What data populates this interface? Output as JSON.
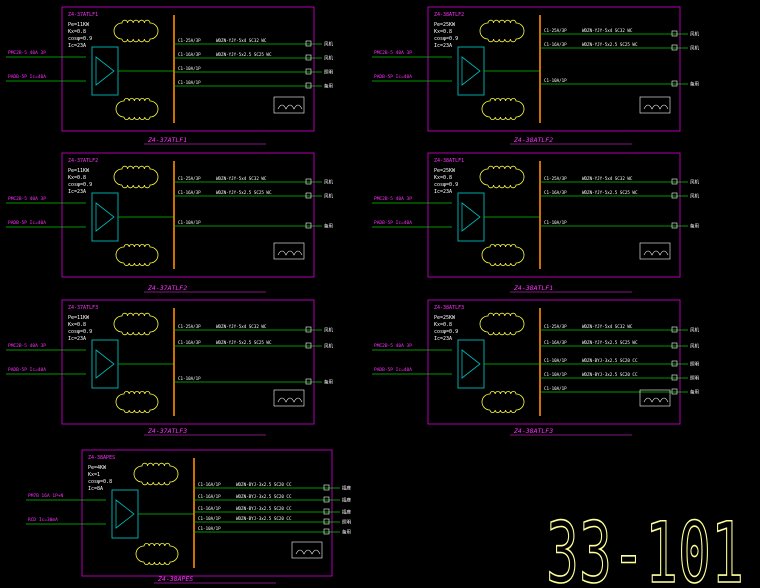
{
  "sheet_number": "33-101",
  "colors": {
    "background": "#000000",
    "frame": "#b000b0",
    "busbar": "#ff8c00",
    "wire": "#00c800",
    "text": "#ffffff",
    "label": "#ff2fff",
    "device": "#00bcbc",
    "cloud": "#ffff40",
    "sheet_number": "#ffff99"
  },
  "panels": [
    {
      "id": "p1",
      "title": "Z4-37ATLF1",
      "specs": [
        "Pe=11KW",
        "Kx=0.8",
        "cosφ=0.9",
        "Ic=23A"
      ],
      "inputs": [
        "PMC2B-5 40A 3P",
        "PADB-5P Ic=40A"
      ],
      "feeders": [
        {
          "breaker": "C1-25A/3P",
          "cable": "WDZN-YJY-5x4 SC32 WC",
          "load": "风机"
        },
        {
          "breaker": "C1-16A/3P",
          "cable": "WDZN-YJY-5x2.5 SC25 WC",
          "load": "风机"
        },
        {
          "breaker": "C1-10A/1P",
          "cable": "",
          "load": "照明"
        },
        {
          "breaker": "C1-10A/1P",
          "cable": "",
          "load": "备用"
        }
      ]
    },
    {
      "id": "p2",
      "title": "Z4-38ATLF2",
      "specs": [
        "Pe=25KW",
        "Kx=0.8",
        "cosφ=0.9",
        "Ic=23A"
      ],
      "inputs": [
        "PMC2B-5 40A 3P",
        "PADB-5P Ic=40A"
      ],
      "feeders": [
        {
          "breaker": "C1-25A/3P",
          "cable": "WDZN-YJY-5x4 SC32 WC",
          "load": "风机"
        },
        {
          "breaker": "C1-16A/3P",
          "cable": "WDZN-YJY-5x2.5 SC25 WC",
          "load": "风机"
        },
        {
          "breaker": "C1-10A/1P",
          "cable": "",
          "load": "备用"
        }
      ]
    },
    {
      "id": "p3",
      "title": "Z4-37ATLF2",
      "specs": [
        "Pe=11KW",
        "Kx=0.8",
        "cosφ=0.9",
        "Ic=23A"
      ],
      "inputs": [
        "PMC2B-5 40A 3P",
        "PADB-5P Ic=40A"
      ],
      "feeders": [
        {
          "breaker": "C1-25A/3P",
          "cable": "WDZN-YJY-5x4 SC32 WC",
          "load": "风机"
        },
        {
          "breaker": "C1-16A/3P",
          "cable": "WDZN-YJY-5x2.5 SC25 WC",
          "load": "风机"
        },
        {
          "breaker": "C1-10A/1P",
          "cable": "",
          "load": "备用"
        }
      ]
    },
    {
      "id": "p4",
      "title": "Z4-38ATLF1",
      "specs": [
        "Pe=25KW",
        "Kx=0.8",
        "cosφ=0.9",
        "Ic=23A"
      ],
      "inputs": [
        "PMC2B-5 40A 3P",
        "PADB-5P Ic=40A"
      ],
      "feeders": [
        {
          "breaker": "C1-25A/3P",
          "cable": "WDZN-YJY-5x4 SC32 WC",
          "load": "风机"
        },
        {
          "breaker": "C1-16A/3P",
          "cable": "WDZN-YJY-5x2.5 SC25 WC",
          "load": "风机"
        },
        {
          "breaker": "C1-10A/1P",
          "cable": "",
          "load": "备用"
        }
      ]
    },
    {
      "id": "p5",
      "title": "Z4-37ATLF3",
      "specs": [
        "Pe=11KW",
        "Kx=0.8",
        "cosφ=0.9",
        "Ic=23A"
      ],
      "inputs": [
        "PMC2B-5 40A 3P",
        "PADB-5P Ic=40A"
      ],
      "feeders": [
        {
          "breaker": "C1-25A/3P",
          "cable": "WDZN-YJY-5x4 SC32 WC",
          "load": "风机"
        },
        {
          "breaker": "C1-16A/3P",
          "cable": "WDZN-YJY-5x2.5 SC25 WC",
          "load": "风机"
        },
        {
          "breaker": "C1-10A/1P",
          "cable": "",
          "load": "备用"
        }
      ]
    },
    {
      "id": "p6",
      "title": "Z4-38ATLF3",
      "specs": [
        "Pe=25KW",
        "Kx=0.8",
        "cosφ=0.9",
        "Ic=23A"
      ],
      "inputs": [
        "PMC2B-5 40A 3P",
        "PADB-5P Ic=40A"
      ],
      "feeders": [
        {
          "breaker": "C1-25A/3P",
          "cable": "WDZN-YJY-5x4 SC32 WC",
          "load": "风机"
        },
        {
          "breaker": "C1-16A/3P",
          "cable": "WDZN-YJY-5x2.5 SC25 WC",
          "load": "风机"
        },
        {
          "breaker": "C1-10A/1P",
          "cable": "WDZN-BYJ-3x2.5 SC20 CC",
          "load": "照明"
        },
        {
          "breaker": "C1-10A/1P",
          "cable": "WDZN-BYJ-3x2.5 SC20 CC",
          "load": "照明"
        },
        {
          "breaker": "C1-10A/1P",
          "cable": "",
          "load": "备用"
        }
      ]
    },
    {
      "id": "p7",
      "title": "Z4-38APES",
      "specs": [
        "Pe=4KW",
        "Kx=1",
        "cosφ=0.8",
        "Ic=8A"
      ],
      "inputs": [
        "PM7B 16A 1P+N",
        "RCD Ic=30mA"
      ],
      "feeders": [
        {
          "breaker": "C1-16A/1P",
          "cable": "WDZN-BYJ-3x2.5 SC20 CC",
          "load": "插座"
        },
        {
          "breaker": "C1-16A/1P",
          "cable": "WDZN-BYJ-3x2.5 SC20 CC",
          "load": "插座"
        },
        {
          "breaker": "C1-16A/1P",
          "cable": "WDZN-BYJ-3x2.5 SC20 CC",
          "load": "插座"
        },
        {
          "breaker": "C1-10A/1P",
          "cable": "WDZN-BYJ-3x2.5 SC20 CC",
          "load": "照明"
        },
        {
          "breaker": "C1-10A/1P",
          "cable": "",
          "load": "备用"
        }
      ]
    }
  ]
}
